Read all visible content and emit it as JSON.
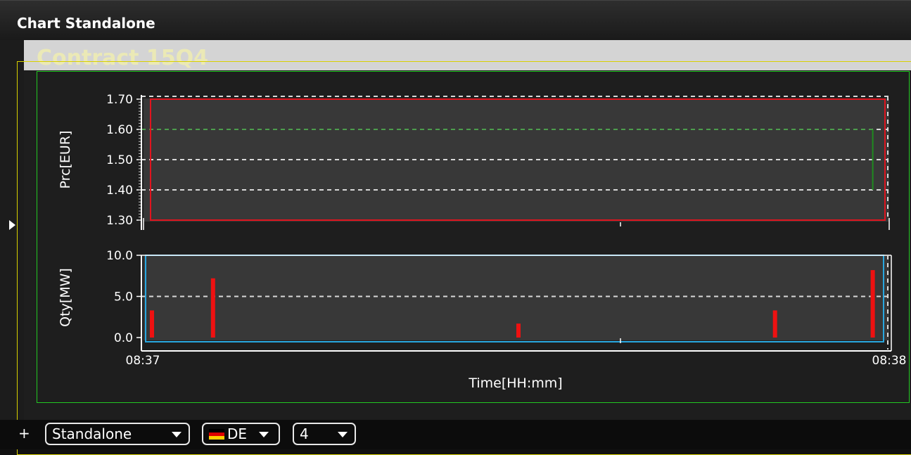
{
  "window": {
    "title": "Chart Standalone"
  },
  "panel": {
    "title": "Contract 15Q4"
  },
  "colors": {
    "price_box": "#e0141e",
    "price_line": "#1f8a1f",
    "qty_box": "#29a7e0",
    "qty_bars": "#ee1111",
    "frame_green": "#22c822",
    "frame_yellow": "#d8d000"
  },
  "chart_data": [
    {
      "type": "line",
      "ylabel": "Prc[EUR]",
      "xlabel": "",
      "ylim": [
        1.3,
        1.7
      ],
      "yticks": [
        "1.70",
        "1.60",
        "1.50",
        "1.40",
        "1.30"
      ],
      "grid": true,
      "series": [
        {
          "x": [
            "08:37:59",
            "08:37:59"
          ],
          "values": [
            1.6,
            1.4
          ]
        }
      ]
    },
    {
      "type": "bar",
      "ylabel": "Qty[MW]",
      "xlabel": "Time[HH:mm]",
      "ylim": [
        0.0,
        10.0
      ],
      "yticks": [
        "10.0",
        "5.0",
        "0.0"
      ],
      "xticks": [
        "08:37",
        "08:38"
      ],
      "grid": true,
      "x": [
        "08:37:00",
        "08:37:05",
        "08:37:30",
        "08:37:51",
        "08:37:59"
      ],
      "values": [
        3.3,
        7.2,
        1.7,
        3.3,
        8.2
      ]
    }
  ],
  "toolbar": {
    "add_label": "+",
    "mode_value": "Standalone",
    "country_value": "DE",
    "count_value": "4"
  }
}
